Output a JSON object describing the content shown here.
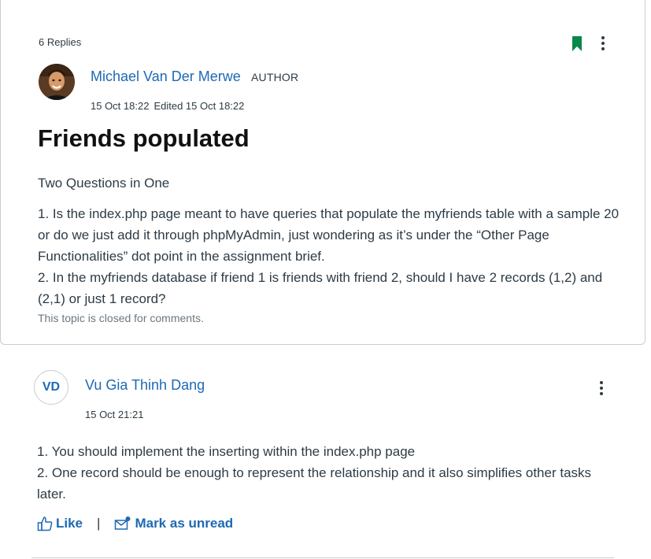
{
  "topic": {
    "replies_count": "6 Replies",
    "author": {
      "name": "Michael Van Der Merwe",
      "role": "AUTHOR",
      "avatar": "profile-photo"
    },
    "posted": "15 Oct 18:22",
    "edited": "Edited 15 Oct 18:22",
    "title": "Friends populated",
    "subtitle": "Two Questions in One",
    "body_lines": [
      "1. Is the index.php page meant to have queries that populate the myfriends table with a sample 20 or do we just add it through phpMyAdmin, just wondering as it’s under the “Other Page Functionalities” dot point in the assignment brief.",
      "2. In the myfriends database if friend 1 is friends with friend 2, should I have 2 records (1,2) and (2,1) or just 1 record?"
    ],
    "closed_note": "This topic is closed for comments.",
    "bookmark_color": "#0b874b"
  },
  "reply": {
    "initials": "VD",
    "author": "Vu Gia Thinh Dang",
    "date": "15 Oct 21:21",
    "body_lines": [
      "1. You should implement the inserting within the index.php page",
      "2. One record should be enough to represent the relationship and it also simplifies other tasks later."
    ],
    "actions": {
      "like_label": "Like",
      "separator": "|",
      "mark_unread_label": "Mark as unread"
    }
  },
  "colors": {
    "link": "#1e69b3",
    "text": "#2d3b45",
    "muted": "#6b7780",
    "border": "#c7cdd1"
  }
}
